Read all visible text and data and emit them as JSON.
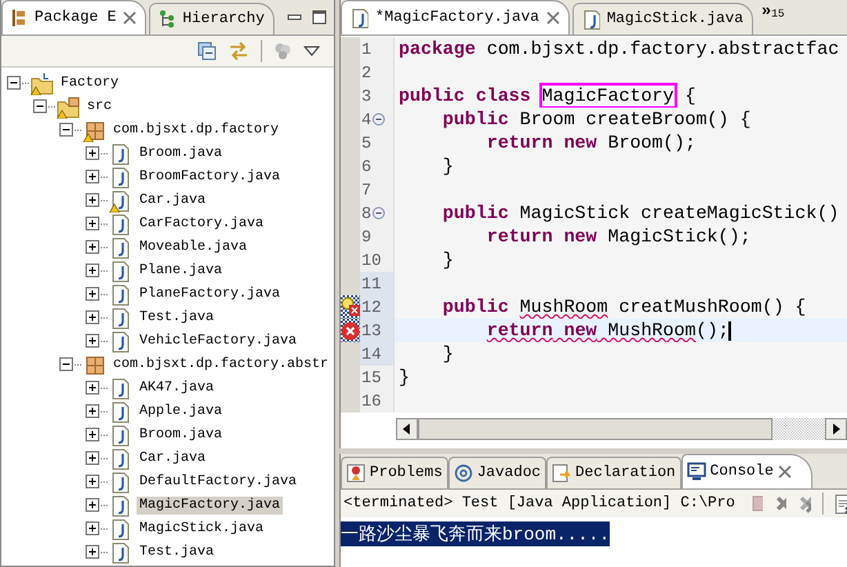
{
  "explorer": {
    "tabs": [
      {
        "label": "Package E",
        "selected": true,
        "closable": true,
        "kind": "package"
      },
      {
        "label": "Hierarchy",
        "selected": false,
        "closable": false,
        "kind": "hierarchy"
      }
    ],
    "tree": [
      {
        "label": "Factory",
        "kind": "project",
        "expanded": true,
        "warning": true,
        "selected": false,
        "children": [
          {
            "label": "src",
            "kind": "srcfolder",
            "expanded": true,
            "warning": true,
            "selected": false,
            "children": [
              {
                "label": "com.bjsxt.dp.factory",
                "kind": "package",
                "expanded": true,
                "warning": true,
                "selected": false,
                "children": [
                  {
                    "label": "Broom.java",
                    "kind": "java",
                    "expanded": false,
                    "warning": false,
                    "selected": false
                  },
                  {
                    "label": "BroomFactory.java",
                    "kind": "java",
                    "expanded": false,
                    "warning": false,
                    "selected": false
                  },
                  {
                    "label": "Car.java",
                    "kind": "java",
                    "expanded": false,
                    "warning": true,
                    "selected": false
                  },
                  {
                    "label": "CarFactory.java",
                    "kind": "java",
                    "expanded": false,
                    "warning": false,
                    "selected": false
                  },
                  {
                    "label": "Moveable.java",
                    "kind": "java",
                    "expanded": false,
                    "warning": false,
                    "selected": false
                  },
                  {
                    "label": "Plane.java",
                    "kind": "java",
                    "expanded": false,
                    "warning": false,
                    "selected": false
                  },
                  {
                    "label": "PlaneFactory.java",
                    "kind": "java",
                    "expanded": false,
                    "warning": false,
                    "selected": false
                  },
                  {
                    "label": "Test.java",
                    "kind": "java",
                    "expanded": false,
                    "warning": false,
                    "selected": false
                  },
                  {
                    "label": "VehicleFactory.java",
                    "kind": "java",
                    "expanded": false,
                    "warning": false,
                    "selected": false
                  }
                ]
              },
              {
                "label": "com.bjsxt.dp.factory.abstr",
                "kind": "package",
                "expanded": true,
                "warning": false,
                "selected": false,
                "children": [
                  {
                    "label": "AK47.java",
                    "kind": "java",
                    "expanded": false,
                    "warning": false,
                    "selected": false
                  },
                  {
                    "label": "Apple.java",
                    "kind": "java",
                    "expanded": false,
                    "warning": false,
                    "selected": false
                  },
                  {
                    "label": "Broom.java",
                    "kind": "java",
                    "expanded": false,
                    "warning": false,
                    "selected": false
                  },
                  {
                    "label": "Car.java",
                    "kind": "java",
                    "expanded": false,
                    "warning": false,
                    "selected": false
                  },
                  {
                    "label": "DefaultFactory.java",
                    "kind": "java",
                    "expanded": false,
                    "warning": false,
                    "selected": false
                  },
                  {
                    "label": "MagicFactory.java",
                    "kind": "java",
                    "expanded": false,
                    "warning": false,
                    "selected": true
                  },
                  {
                    "label": "MagicStick.java",
                    "kind": "java",
                    "expanded": false,
                    "warning": false,
                    "selected": false
                  },
                  {
                    "label": "Test.java",
                    "kind": "java",
                    "expanded": false,
                    "warning": false,
                    "selected": false
                  }
                ]
              }
            ]
          }
        ]
      }
    ]
  },
  "editor": {
    "tabs": [
      {
        "label": "*MagicFactory.java",
        "selected": true,
        "closable": true
      },
      {
        "label": "MagicStick.java",
        "selected": false,
        "closable": false
      }
    ],
    "overflow": {
      "chevron": "»",
      "count": "15"
    },
    "lines": [
      {
        "number": "1",
        "kind": "plain",
        "fold": false,
        "range": false,
        "current": false,
        "tokens": [
          {
            "kind": "keyword",
            "text": "package"
          },
          {
            "kind": "plain",
            "text": " com.bjsxt.dp.factory.abstractfac"
          }
        ]
      },
      {
        "number": "2",
        "kind": "plain",
        "fold": false,
        "range": false,
        "current": false
      },
      {
        "number": "3",
        "kind": "plain",
        "fold": false,
        "range": false,
        "current": false,
        "tokens": [
          {
            "kind": "keyword",
            "text": "public"
          },
          {
            "kind": "keyword",
            "text": " class "
          },
          {
            "kind": "boxed",
            "text": "MagicFactory"
          },
          {
            "kind": "plain",
            "text": " {"
          }
        ]
      },
      {
        "number": "4",
        "kind": "plain",
        "fold": true,
        "range": false,
        "current": false,
        "tokens": [
          {
            "kind": "keyword",
            "text": "    public"
          },
          {
            "kind": "plain",
            "text": " Broom createBroom() {"
          }
        ]
      },
      {
        "number": "5",
        "kind": "plain",
        "fold": false,
        "range": false,
        "current": false,
        "tokens": [
          {
            "kind": "keyword",
            "text": "        return"
          },
          {
            "kind": "keyword",
            "text": " new"
          },
          {
            "kind": "plain",
            "text": " Broom();"
          }
        ]
      },
      {
        "number": "6",
        "kind": "plain",
        "fold": false,
        "range": false,
        "current": false,
        "tokens": [
          {
            "kind": "plain",
            "text": "    }"
          }
        ]
      },
      {
        "number": "7",
        "kind": "plain",
        "fold": false,
        "range": false,
        "current": false
      },
      {
        "number": "8",
        "kind": "plain",
        "fold": true,
        "range": false,
        "current": false,
        "tokens": [
          {
            "kind": "keyword",
            "text": "    public"
          },
          {
            "kind": "plain",
            "text": " MagicStick createMagicStick()"
          }
        ]
      },
      {
        "number": "9",
        "kind": "plain",
        "fold": false,
        "range": false,
        "current": false,
        "tokens": [
          {
            "kind": "keyword",
            "text": "        return"
          },
          {
            "kind": "keyword",
            "text": " new"
          },
          {
            "kind": "plain",
            "text": " MagicStick();"
          }
        ]
      },
      {
        "number": "10",
        "kind": "plain",
        "fold": false,
        "range": false,
        "current": false,
        "tokens": [
          {
            "kind": "plain",
            "text": "    }"
          }
        ]
      },
      {
        "number": "11",
        "kind": "plain",
        "fold": false,
        "range": true,
        "current": false
      },
      {
        "number": "12",
        "kind": "quickfix",
        "fold": false,
        "range": true,
        "current": false,
        "tokens": [
          {
            "kind": "keyword",
            "text": "    public "
          },
          {
            "kind": "plain_error",
            "text": "MushRoom"
          },
          {
            "kind": "plain",
            "text": " creatMushRoom() {"
          }
        ]
      },
      {
        "number": "13",
        "kind": "error",
        "fold": false,
        "range": true,
        "current": true,
        "tokens": [
          {
            "kind": "keyword_error",
            "text": "        return"
          },
          {
            "kind": "keyword_error",
            "text": " new"
          },
          {
            "kind": "plain_error",
            "text": " MushRoom"
          },
          {
            "kind": "plain",
            "text": "();"
          }
        ]
      },
      {
        "number": "14",
        "kind": "plain",
        "fold": false,
        "range": true,
        "current": false,
        "tokens": [
          {
            "kind": "plain",
            "text": "    }"
          }
        ]
      },
      {
        "number": "15",
        "kind": "plain",
        "fold": false,
        "range": false,
        "current": false,
        "tokens": [
          {
            "kind": "plain",
            "text": "}"
          }
        ]
      },
      {
        "number": "16",
        "kind": "plain",
        "fold": false,
        "range": false,
        "current": false
      }
    ]
  },
  "console": {
    "tabs": [
      {
        "label": "Problems",
        "selected": false,
        "closable": false,
        "kind": "problems"
      },
      {
        "label": "Javadoc",
        "selected": false,
        "closable": false,
        "kind": "javadoc"
      },
      {
        "label": "Declaration",
        "selected": false,
        "closable": false,
        "kind": "declaration"
      },
      {
        "label": "Console",
        "selected": true,
        "closable": true,
        "kind": "console"
      }
    ],
    "header": "<terminated> Test [Java Application] C:\\Pro",
    "output": [
      {
        "text": "一路沙尘暴飞奔而来broom.....",
        "selected": true
      }
    ]
  }
}
